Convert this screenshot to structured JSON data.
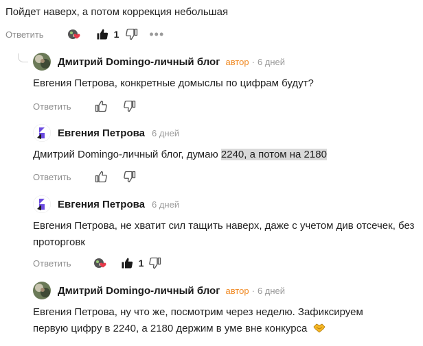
{
  "top_comment": {
    "text": "Пойдет наверх, а потом коррекция небольшая",
    "reply_label": "Ответить",
    "like_count": "1",
    "more_label": "•••"
  },
  "replies": [
    {
      "author": "Дмитрий Domingo-личный блог",
      "author_badge": "автор",
      "separator": "·",
      "time": "6 дней",
      "text": "Евгения Петрова, конкретные домыслы по цифрам будут?",
      "reply_label": "Ответить"
    },
    {
      "author": "Евгения Петрова",
      "time": "6 дней",
      "text_before": "Дмитрий Domingo-личный блог, думаю ",
      "text_highlight": "2240, а потом на 2180",
      "reply_label": "Ответить"
    },
    {
      "author": "Евгения Петрова",
      "time": "6 дней",
      "text": "Евгения Петрова, не хватит сил тащить наверх, даже с учетом див отсечек, без проторговк",
      "reply_label": "Ответить",
      "like_count": "1"
    },
    {
      "author": "Дмитрий Domingo-личный блог",
      "author_badge": "автор",
      "separator": "·",
      "time": "6 дней",
      "text": "Евгения Петрова, ну что же, посмотрим через неделю. Зафиксируем первую цифру в 2240, а 2180 держим в уме вне конкурса",
      "reply_label": "Ответить"
    }
  ],
  "colors": {
    "author_badge": "#f08a24",
    "muted": "#8c8c8c",
    "highlight": "#d9d9d9",
    "purple_avatar": "#6c4ce0"
  },
  "icons": [
    "reactions-icon",
    "thumbs-up-icon",
    "thumbs-down-icon",
    "more-icon",
    "handshake-emoji-icon"
  ]
}
